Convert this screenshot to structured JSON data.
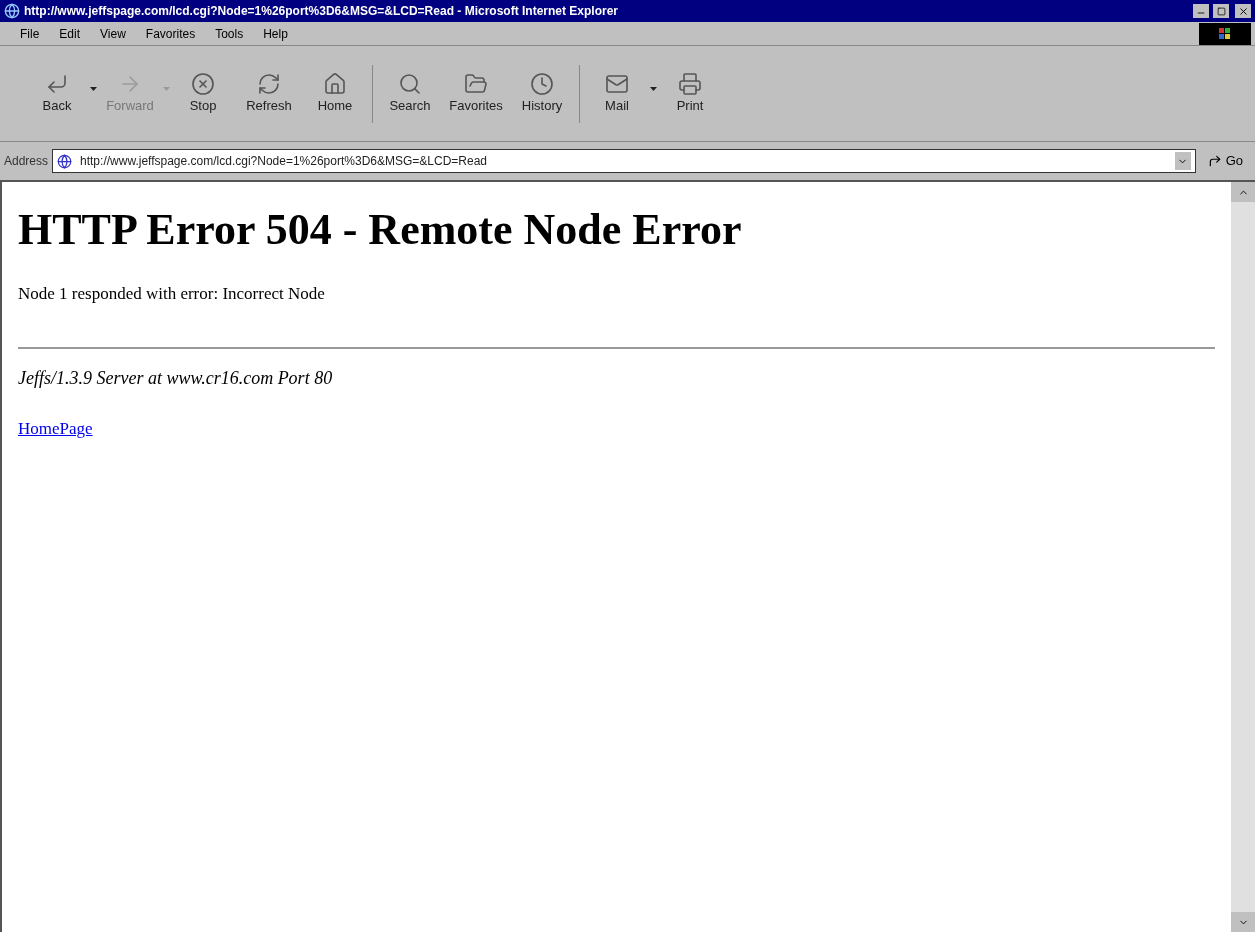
{
  "window": {
    "title": "http://www.jeffspage.com/lcd.cgi?Node=1%26port%3D6&MSG=&LCD=Read - Microsoft Internet Explorer"
  },
  "menu": [
    "File",
    "Edit",
    "View",
    "Favorites",
    "Tools",
    "Help"
  ],
  "toolbar": [
    {
      "label": "Back",
      "kind": "back",
      "disabled": false,
      "dropdown": true
    },
    {
      "label": "Forward",
      "kind": "forward",
      "disabled": true,
      "dropdown": true
    },
    {
      "label": "Stop",
      "kind": "stop",
      "disabled": false,
      "dropdown": false
    },
    {
      "label": "Refresh",
      "kind": "refresh",
      "disabled": false,
      "dropdown": false
    },
    {
      "label": "Home",
      "kind": "home",
      "disabled": false,
      "dropdown": false
    },
    {
      "label": "Search",
      "kind": "search",
      "disabled": false,
      "dropdown": false
    },
    {
      "label": "Favorites",
      "kind": "favorites",
      "disabled": false,
      "dropdown": false
    },
    {
      "label": "History",
      "kind": "history",
      "disabled": false,
      "dropdown": false
    },
    {
      "label": "Mail",
      "kind": "mail",
      "disabled": false,
      "dropdown": true
    },
    {
      "label": "Print",
      "kind": "print",
      "disabled": false,
      "dropdown": false
    }
  ],
  "address": {
    "label": "Address",
    "value": "http://www.jeffspage.com/lcd.cgi?Node=1%26port%3D6&MSG=&LCD=Read",
    "go": "Go"
  },
  "page": {
    "heading": "HTTP Error 504 - Remote Node Error",
    "message": "Node 1 responded with error: Incorrect Node",
    "server": "Jeffs/1.3.9 Server at www.cr16.com Port 80",
    "link": "HomePage"
  }
}
